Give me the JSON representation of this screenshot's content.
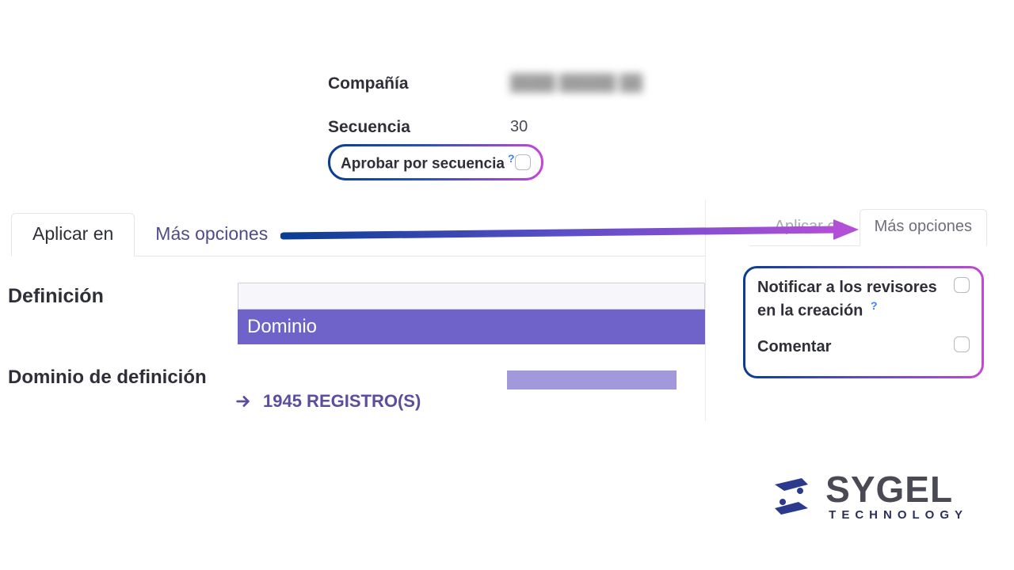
{
  "form": {
    "company_label": "Compañía",
    "company_value": "████ █████ ██",
    "sequence_label": "Secuencia",
    "sequence_value": "30",
    "approve_by_sequence_label": "Aprobar por secuencia",
    "help_marker": "?"
  },
  "tabs": {
    "apply_in": "Aplicar en",
    "more_options": "Más opciones"
  },
  "right_tabs": {
    "apply_in": "Aplicar en",
    "more_options": "Más opciones"
  },
  "body": {
    "definition_label": "Definición",
    "domain_title": "Dominio",
    "definition_domain_label": "Dominio de definición",
    "dropdown_option": "Dominio",
    "records_count": "1945 REGISTRO(S)"
  },
  "options_card": {
    "notify_label": "Notificar a los revisores en la creación",
    "help_marker": "?",
    "comment_label": "Comentar"
  },
  "logo": {
    "name": "SYGEL",
    "sub": "TECHNOLOGY"
  },
  "colors": {
    "grad_start": "#0b3d91",
    "grad_mid": "#2a52be",
    "grad_end": "#c447d6",
    "accent_purple": "#6f62c8",
    "link_purple": "#5a4ea0"
  }
}
